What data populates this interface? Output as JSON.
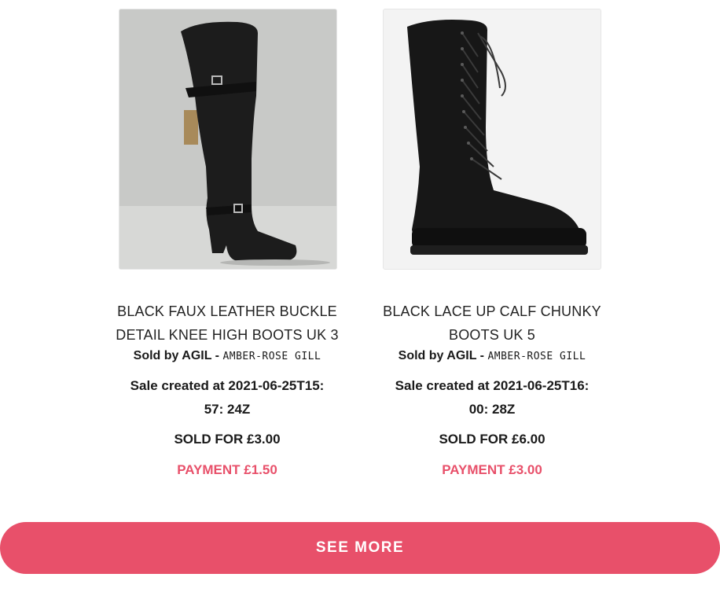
{
  "products": [
    {
      "title": "BLACK FAUX LEATHER BUCKLE DETAIL KNEE HIGH BOOTS UK 3",
      "seller_prefix": "Sold by AGIL - ",
      "seller_name": "AMBER-ROSE GILL",
      "created": "Sale created at 2021-06-25T15: 57: 24Z",
      "sold": "SOLD FOR £3.00",
      "payment": "PAYMENT £1.50"
    },
    {
      "title": "BLACK LACE UP CALF CHUNKY BOOTS UK 5",
      "seller_prefix": "Sold by AGIL - ",
      "seller_name": "AMBER-ROSE GILL",
      "created": "Sale created at 2021-06-25T16: 00: 28Z",
      "sold": "SOLD FOR £6.00",
      "payment": "PAYMENT £3.00"
    }
  ],
  "see_more_label": "SEE MORE",
  "colors": {
    "accent": "#e8506a",
    "text": "#1a1a1a",
    "background": "#ffffff"
  }
}
